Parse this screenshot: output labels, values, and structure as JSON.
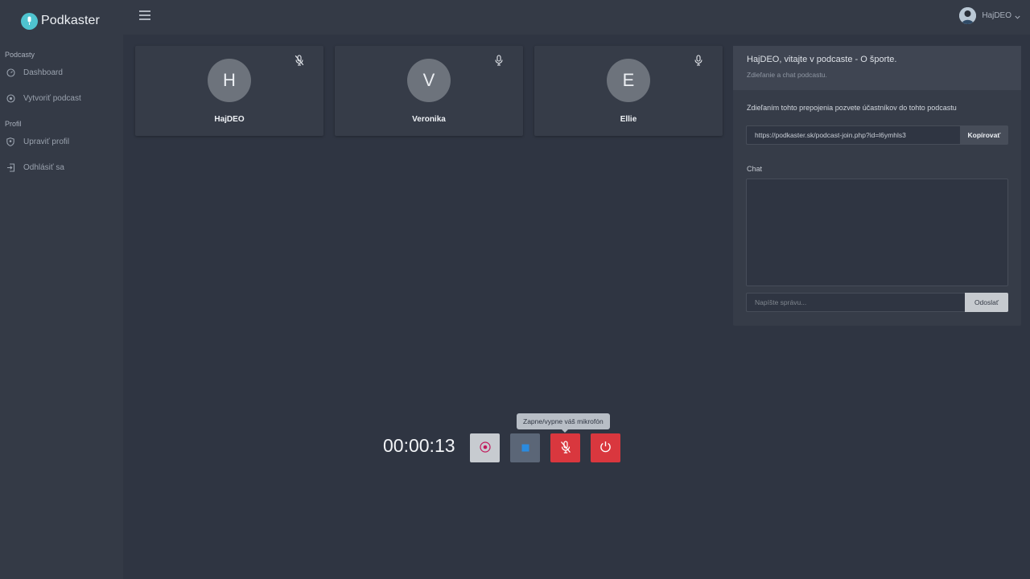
{
  "brand": {
    "name": "Podkaster",
    "logo_icon": "mic-icon",
    "accent": "#4fc3cf"
  },
  "sidebar": {
    "sections": [
      {
        "title": "Podcasty",
        "items": [
          {
            "label": "Dashboard",
            "icon": "dashboard-icon"
          },
          {
            "label": "Vytvoriť podcast",
            "icon": "circle-dot-icon"
          }
        ]
      },
      {
        "title": "Profil",
        "items": [
          {
            "label": "Upraviť profil",
            "icon": "shield-user-icon"
          },
          {
            "label": "Odhlásiť sa",
            "icon": "logout-icon"
          }
        ]
      }
    ]
  },
  "topbar": {
    "user_name": "HajDEO"
  },
  "participants": [
    {
      "initial": "H",
      "name": "HajDEO",
      "mic": "muted"
    },
    {
      "initial": "V",
      "name": "Veronika",
      "mic": "on"
    },
    {
      "initial": "E",
      "name": "Ellie",
      "mic": "on"
    }
  ],
  "panel": {
    "title": "HajDEO, vitajte v podcaste - O športe.",
    "subtitle": "Zdieľanie a chat podcastu.",
    "share_text": "Zdieľaním tohto prepojenia pozvete účastníkov do tohto podcastu",
    "share_link": "https://podkaster.sk/podcast-join.php?id=l6ymhls3",
    "copy_label": "Kopírovať",
    "chat_label": "Chat",
    "message_placeholder": "Napíšte správu...",
    "send_label": "Odoslať"
  },
  "controls": {
    "timer": "00:00:13",
    "tooltip": "Zapne/vypne váš mikrofón",
    "colors": {
      "danger": "#d9373e",
      "record": "#c7cbd0",
      "stop": "#5b6677"
    }
  }
}
